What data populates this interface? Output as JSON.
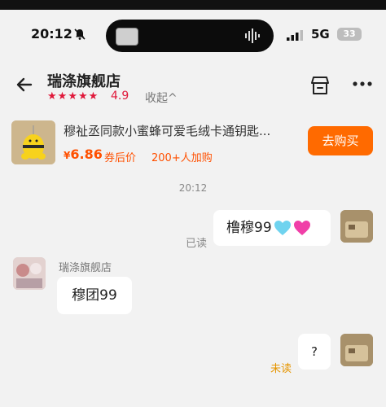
{
  "status": {
    "time": "20:12",
    "network": "5G",
    "battery": "33"
  },
  "header": {
    "shop_name": "瑞涤旗舰店",
    "rating": "4.9",
    "stars_count": 5,
    "collapse_label": "收起^"
  },
  "product": {
    "title": "穆祉丞同款小蜜蜂可爱毛绒卡通钥匙...",
    "currency": "¥",
    "price": "6.86",
    "price_tag": "券后价",
    "buyers": "200+人加购",
    "buy_label": "去购买"
  },
  "chat": {
    "timestamp": "20:12",
    "messages": [
      {
        "from": "me",
        "text": "橹穆99",
        "emojis": [
          "light-blue-heart",
          "pink-heart"
        ],
        "status": "已读"
      },
      {
        "from": "shop",
        "sender": "瑞涤旗舰店",
        "text": "穆团99"
      },
      {
        "from": "me",
        "text": "?",
        "status": "未读"
      }
    ]
  },
  "colors": {
    "accent": "#ff5000",
    "buy_button": "#ff6a00",
    "star": "#e0183a",
    "unread": "#e69500",
    "background": "#f2f2f2"
  }
}
